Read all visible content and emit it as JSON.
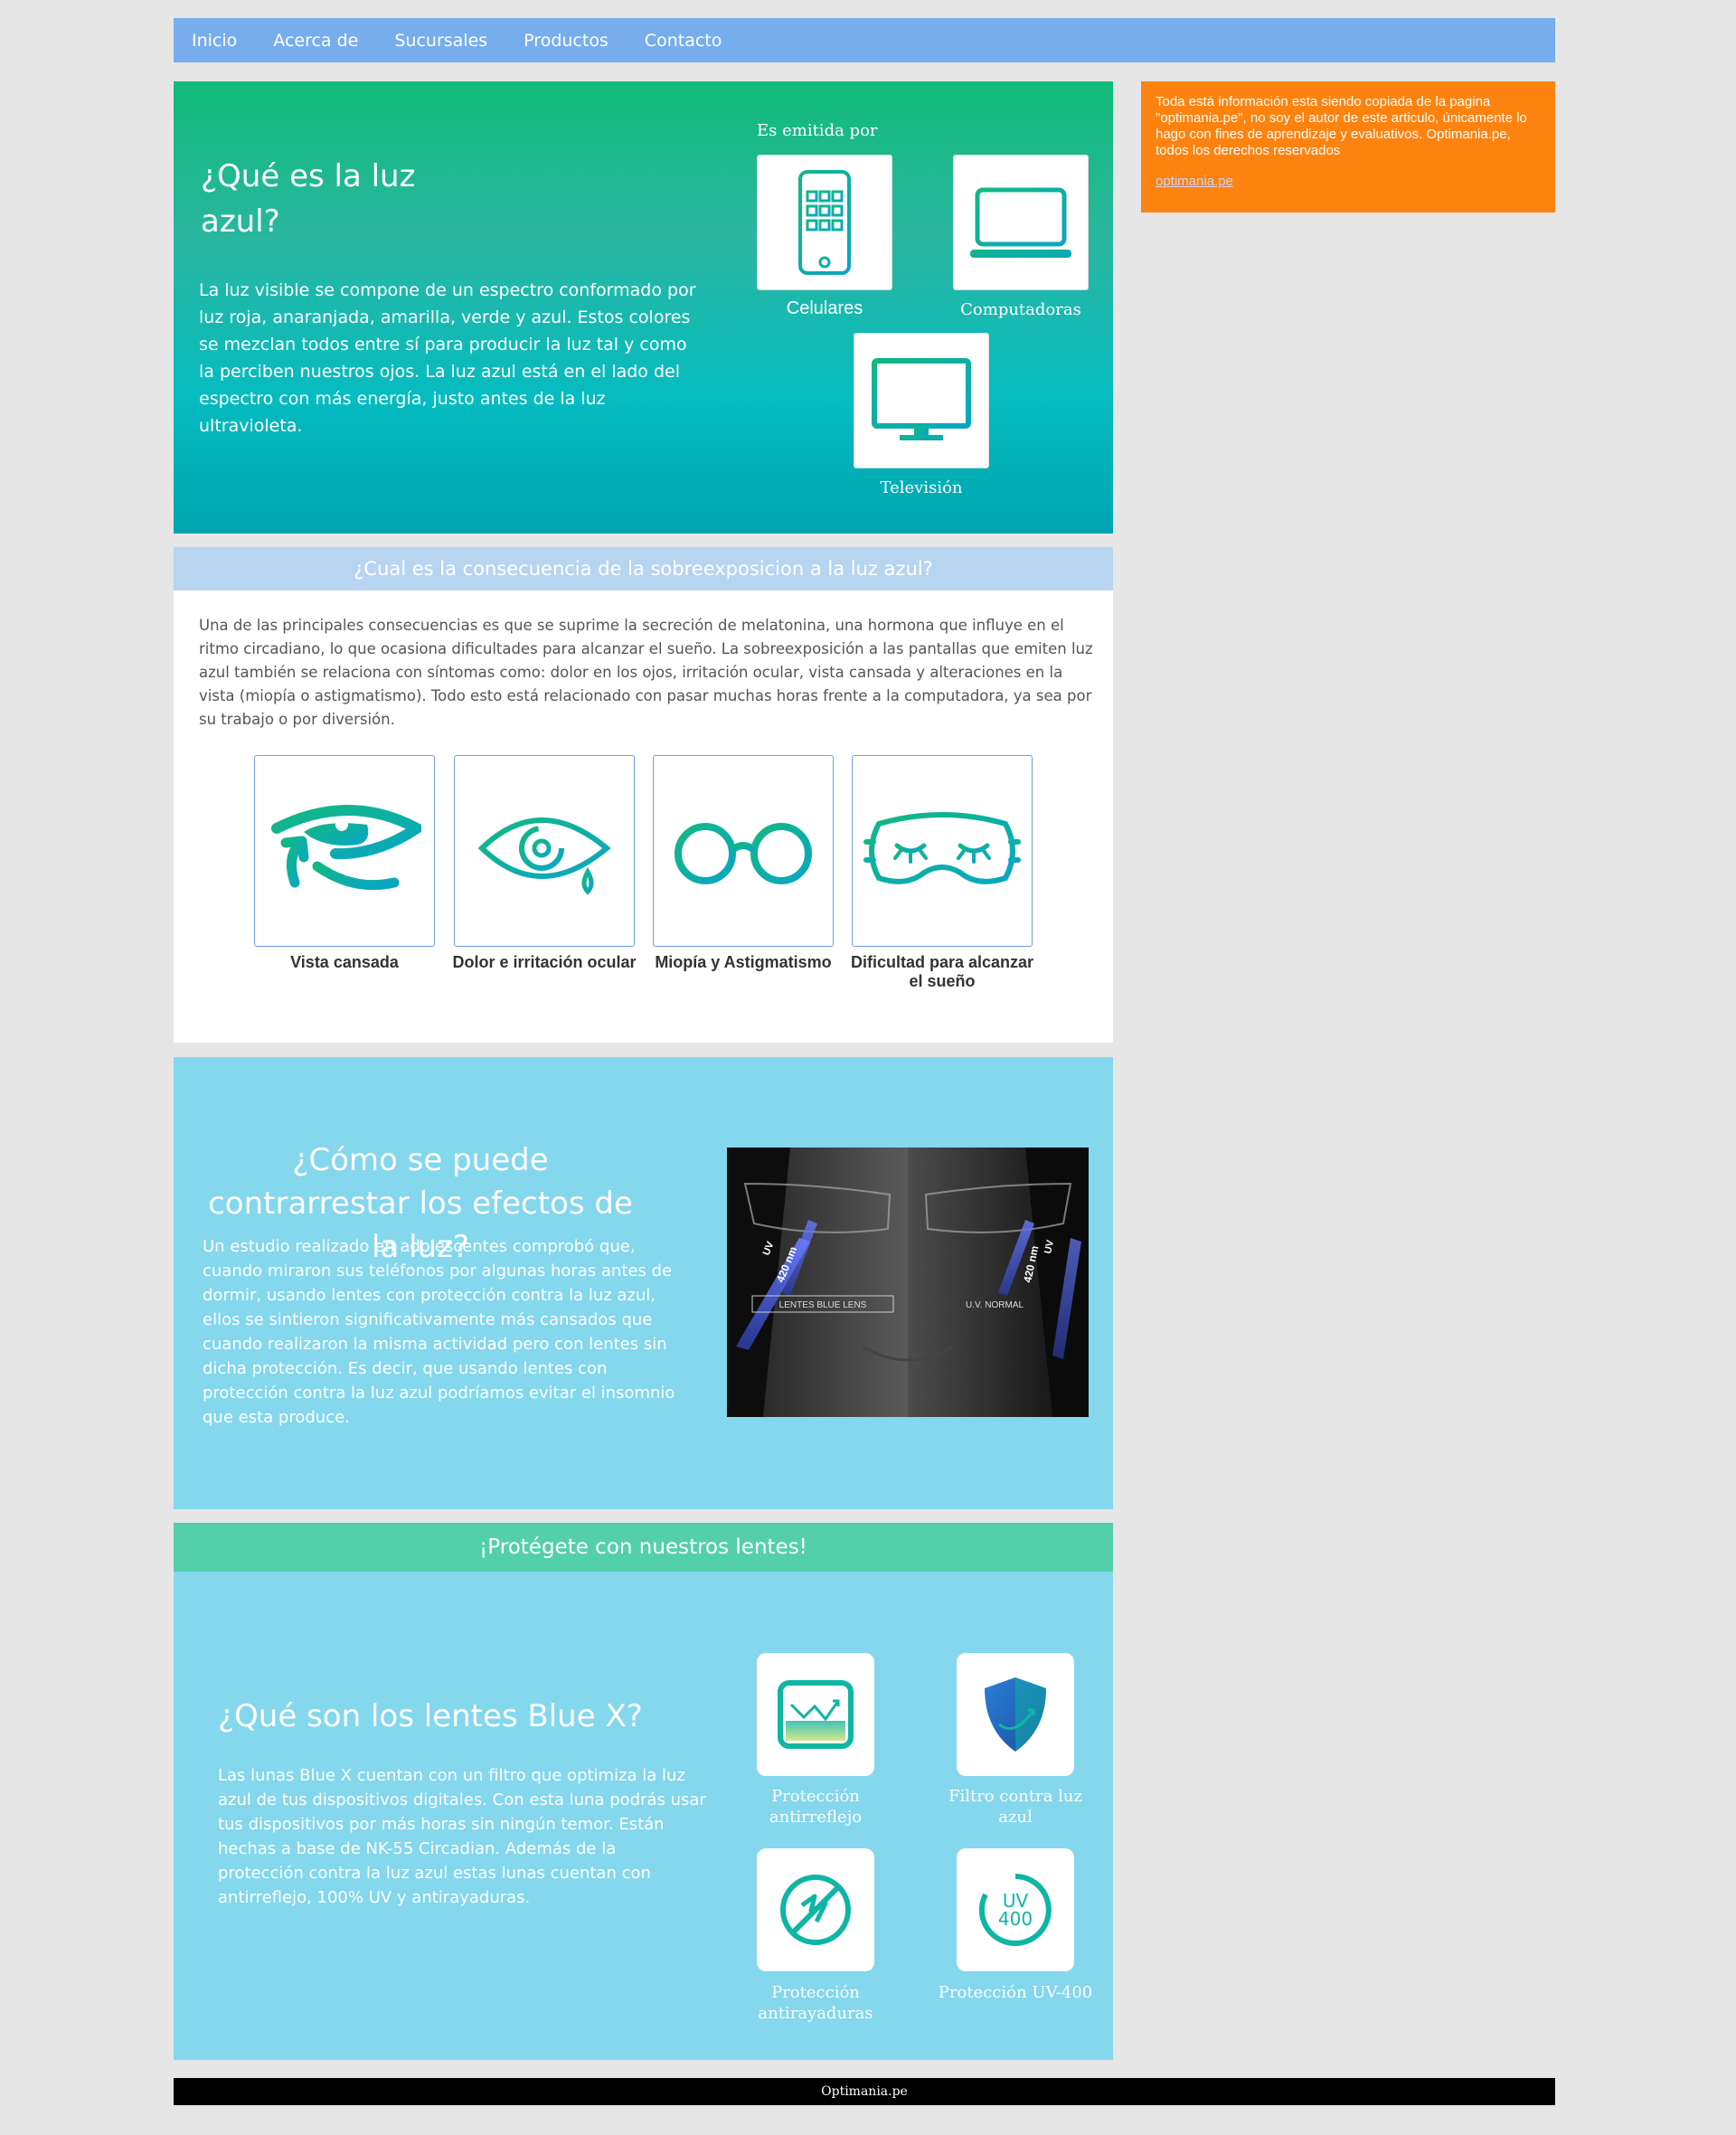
{
  "nav": {
    "items": [
      "Inicio",
      "Acerca de",
      "Sucursales",
      "Productos",
      "Contacto"
    ]
  },
  "aside": {
    "text": "Toda está información esta siendo copiada de la pagina \"optimania.pe\", no soy el autor de este articulo, únicamente lo hago con fines de aprendizaje y evaluativos. Optimania.pe, todos los derechos reservados",
    "link": "optimania.pe"
  },
  "hero": {
    "title": "¿Qué es la luz azul?",
    "text": "La luz visible se compone de un espectro conformado por luz roja, anaranjada, amarilla, verde y azul. Estos colores se mezclan todos entre sí para producir la luz tal y como la perciben nuestros ojos. La luz azul está en el lado del espectro con más energía, justo antes de la luz ultravioleta.",
    "emitted_by": "Es emitida por",
    "devices": [
      "Celulares",
      "Computadoras",
      "Televisión"
    ]
  },
  "consequence": {
    "heading": "¿Cual es la consecuencia de la sobreexposicion a la luz azul?",
    "text": "Una de las principales consecuencias es que se suprime la secreción de melatonina, una hormona que influye en el ritmo circadiano, lo que ocasiona dificultades para alcanzar el sueño. La sobreexposición a las pantallas que emiten luz azul también se relaciona con síntomas como: dolor en los ojos, irritación ocular, vista cansada y alteraciones en la vista (miopía o astigmatismo). Todo esto está relacionado con pasar muchas horas frente a la computadora, ya sea por su trabajo o por diversión.",
    "cards": [
      "Vista cansada",
      "Dolor e irritación ocular",
      "Miopía y Astigmatismo",
      "Dificultad para alcanzar el sueño"
    ]
  },
  "counter": {
    "title": "¿Cómo se puede contrarrestar los efectos de la luz?",
    "text": "Un estudio realizado en adolescentes comprobó que, cuando miraron sus teléfonos por algunas horas antes de dormir, usando lentes con protección contra la luz azul, ellos se sintieron significativamente más cansados que cuando realizaron la misma actividad pero con lentes sin dicha protección. Es decir, que usando lentes con protección contra la luz azul podríamos evitar el insomnio que esta produce.",
    "photo_labels": {
      "left": "LENTES BLUE LENS",
      "right": "U.V. NORMAL",
      "nm": "420 nm",
      "uv": "UV"
    }
  },
  "protect": {
    "heading": "¡Protégete con nuestros lentes!",
    "title": "¿Qué son los lentes Blue X?",
    "text": "Las lunas Blue X cuentan con un filtro que optimiza la luz azul de tus dispositivos digitales. Con esta luna podrás usar tus dispositivos por más horas sin ningún temor. Están hechas a base de NK-55 Circadian. Además de la protección contra la luz azul estas lunas cuentan con antirreflejo, 100% UV y antirayaduras.",
    "features": [
      "Protección antirreflejo",
      "Filtro contra luz azul",
      "Protección antirayaduras",
      "Protección UV-400"
    ],
    "uv_badge": {
      "top": "UV",
      "bottom": "400"
    }
  },
  "footer": {
    "text": "Optimania.pe"
  },
  "colors": {
    "nav": "#77aded",
    "aside": "#fd8310",
    "accent": "#13b7a0",
    "light_blue": "#84d7ec",
    "green_head": "#53d0aa"
  }
}
